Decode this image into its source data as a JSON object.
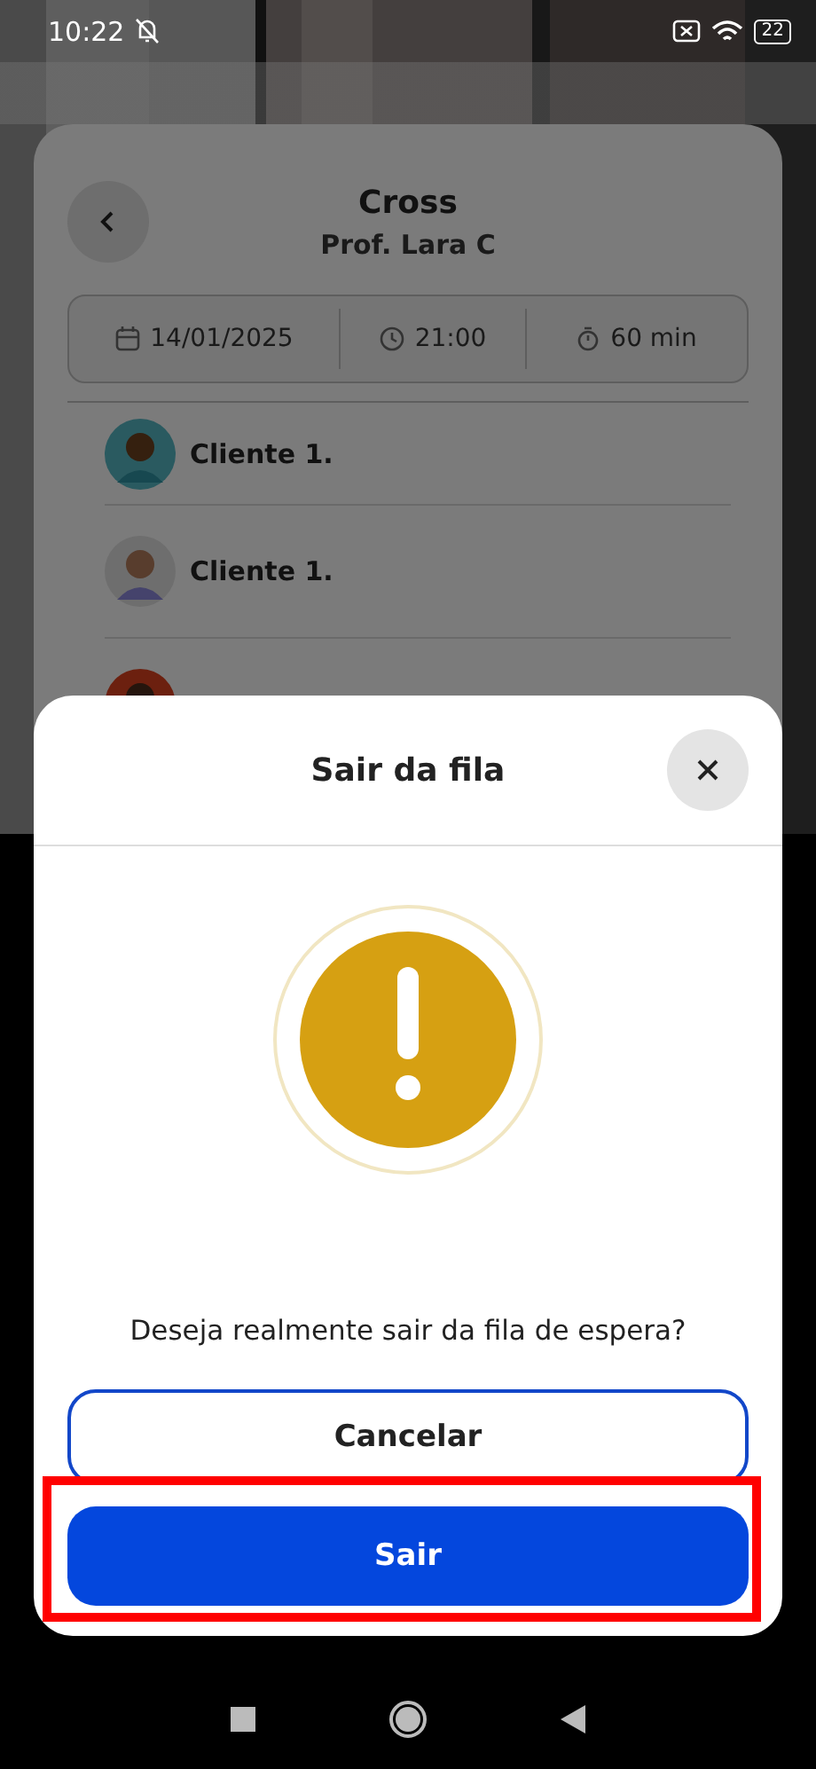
{
  "status_bar": {
    "time": "10:22",
    "battery": "22"
  },
  "class_card": {
    "title": "Cross",
    "instructor": "Prof. Lara C",
    "date": "14/01/2025",
    "time": "21:00",
    "duration": "60 min"
  },
  "clients": [
    {
      "name": "Cliente 1."
    },
    {
      "name": "Cliente 1."
    }
  ],
  "dialog": {
    "title": "Sair da fila",
    "message": "Deseja realmente sair da fila de espera?",
    "buttons": [
      {
        "label": "Cancelar",
        "kind": "secondary"
      },
      {
        "label": "Sair",
        "kind": "primary",
        "highlighted": true
      }
    ]
  }
}
